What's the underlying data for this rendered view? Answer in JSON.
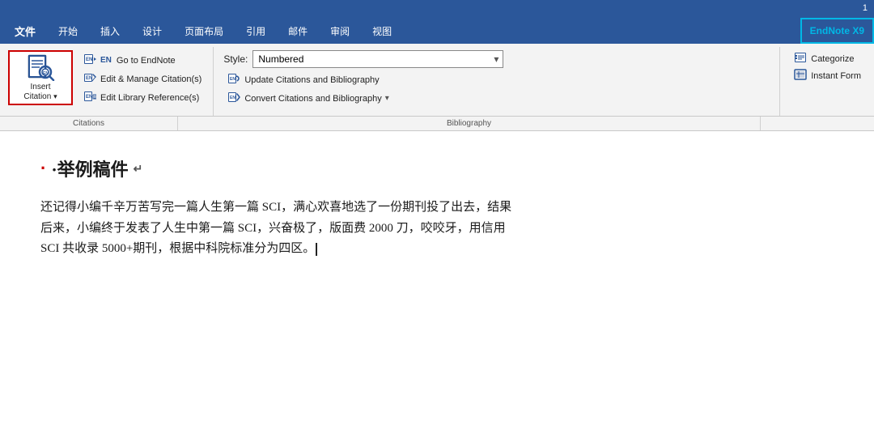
{
  "titlebar": {
    "page_number": "1"
  },
  "tabs": {
    "file": "文件",
    "start": "开始",
    "insert": "插入",
    "design": "设计",
    "layout": "页面布局",
    "reference": "引用",
    "mail": "邮件",
    "review": "审阅",
    "view": "视图",
    "endnote": "EndNote X9"
  },
  "insert_citation": {
    "label_line1": "Insert",
    "label_line2": "Citation",
    "dropdown_marker": "▾"
  },
  "small_buttons": {
    "go_to_endnote": "Go to EndNote",
    "edit_manage": "Edit & Manage Citation(s)",
    "edit_library": "Edit Library Reference(s)",
    "en_label": "EN"
  },
  "style_section": {
    "style_label": "Style:",
    "style_value": "Numbered",
    "update_citations": "Update Citations and Bibliography",
    "convert_citations": "Convert Citations and Bibliography",
    "convert_arrow": "▾"
  },
  "categorize_section": {
    "categorize_label": "Categorize",
    "instant_form_label": "Instant Form"
  },
  "group_labels": {
    "citations": "Citations",
    "bibliography": "Bibliography"
  },
  "document": {
    "heading": "·举例稿件",
    "paragraph1": "还记得小编千辛万苦写完一篇人生第一篇 SCI，满心欢喜地选了一份期刊投了出去，结果",
    "paragraph2": "后来，小编终于发表了人生中第一篇 SCI，兴奋极了，版面费 2000 刀，咬咬牙，用信用",
    "paragraph3": "SCI 共收录 5000+期刊，根据中科院标准分为四区。"
  }
}
